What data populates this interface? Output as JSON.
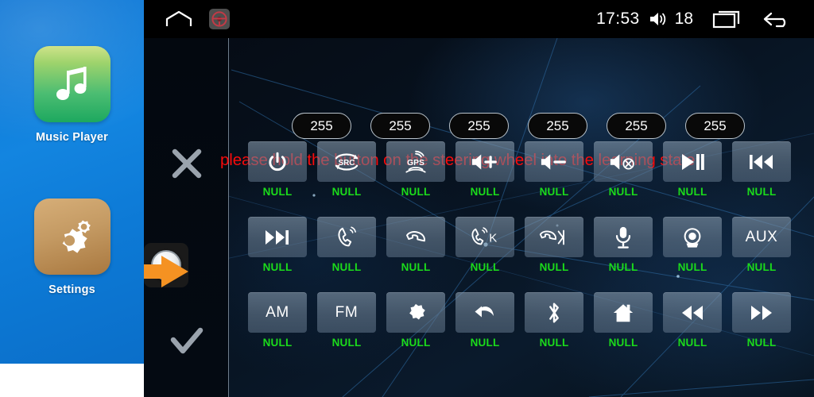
{
  "sidebar": {
    "apps": [
      {
        "label": "Music Player",
        "icon": "music-note-icon",
        "tile_color": "#4cbd72"
      },
      {
        "label": "Settings",
        "icon": "gears-icon",
        "tile_color": "#c49a63"
      }
    ]
  },
  "statusbar": {
    "home_icon": "home-outline-icon",
    "steering_icon": "steering-wheel-icon",
    "clock": "17:53",
    "volume_icon": "volume-icon",
    "volume_value": "18",
    "recents_icon": "recent-apps-icon",
    "back_icon": "back-arrow-icon"
  },
  "gutter": {
    "cancel_icon": "close-x-icon",
    "confirm_icon": "checkmark-icon",
    "knob_icon": "round-knob-icon",
    "arrow_icon": "orange-arrow-icon",
    "accent_color": "#f59222"
  },
  "main": {
    "warning_message": "please hold the button on the steering wheel into the learning state!",
    "warning_color": "#fa0a0a",
    "label_color": "#1bdb1b",
    "value_pills": [
      "255",
      "255",
      "255",
      "255",
      "255",
      "255"
    ],
    "functions": [
      {
        "icon": "power-icon",
        "text": "",
        "label": "NULL"
      },
      {
        "icon": "src-icon",
        "text": "",
        "label": "NULL"
      },
      {
        "icon": "gps-icon",
        "text": "",
        "label": "NULL"
      },
      {
        "icon": "volume-up-icon",
        "text": "",
        "label": "NULL"
      },
      {
        "icon": "volume-down-icon",
        "text": "",
        "label": "NULL"
      },
      {
        "icon": "mute-icon",
        "text": "",
        "label": "NULL"
      },
      {
        "icon": "play-pause-icon",
        "text": "",
        "label": "NULL"
      },
      {
        "icon": "previous-track-icon",
        "text": "",
        "label": "NULL"
      },
      {
        "icon": "next-track-icon",
        "text": "",
        "label": "NULL"
      },
      {
        "icon": "answer-call-icon",
        "text": "",
        "label": "NULL"
      },
      {
        "icon": "hangup-call-icon",
        "text": "",
        "label": "NULL"
      },
      {
        "icon": "call-key-icon",
        "text": "",
        "label": "NULL"
      },
      {
        "icon": "hangup-next-icon",
        "text": "",
        "label": "NULL"
      },
      {
        "icon": "microphone-icon",
        "text": "",
        "label": "NULL"
      },
      {
        "icon": "camera-icon",
        "text": "",
        "label": "NULL"
      },
      {
        "icon": "aux-text",
        "text": "AUX",
        "label": "NULL"
      },
      {
        "icon": "am-text",
        "text": "AM",
        "label": "NULL"
      },
      {
        "icon": "fm-text",
        "text": "FM",
        "label": "NULL"
      },
      {
        "icon": "gear-icon",
        "text": "",
        "label": "NULL"
      },
      {
        "icon": "back-curve-icon",
        "text": "",
        "label": "NULL"
      },
      {
        "icon": "bluetooth-icon",
        "text": "",
        "label": "NULL"
      },
      {
        "icon": "home-icon",
        "text": "",
        "label": "NULL"
      },
      {
        "icon": "rewind-icon",
        "text": "",
        "label": "NULL"
      },
      {
        "icon": "fast-forward-icon",
        "text": "",
        "label": "NULL"
      }
    ]
  }
}
